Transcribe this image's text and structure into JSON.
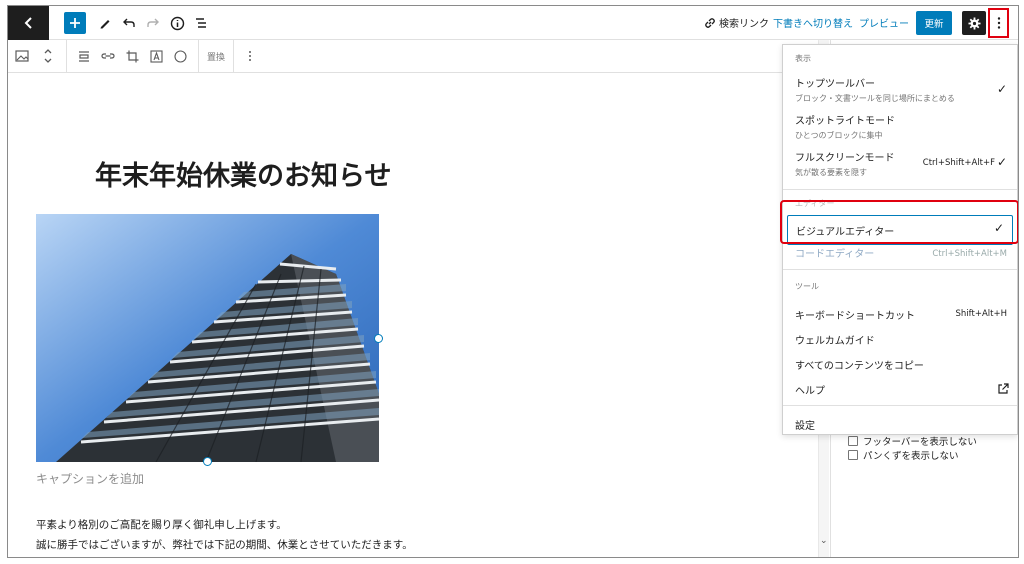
{
  "topbar": {
    "preview_link_label": "検索リンク",
    "switch_to_draft_label": "下書きへ切り替え",
    "preview_label": "プレビュー",
    "update_label": "更新"
  },
  "blockbar": {
    "replace_label": "置換"
  },
  "post": {
    "title": "年末年始休業のお知らせ",
    "caption_placeholder": "キャプションを追加",
    "paragraph_1": "平素より格別のご高配を賜り厚く御礼申し上げます。",
    "paragraph_2": "誠に勝手ではございますが、弊社では下記の期間、休業とさせていただきます。"
  },
  "sidebar": {
    "options": [
      "フッターバーを表示しない",
      "パンくずを表示しない"
    ]
  },
  "menu": {
    "view_heading": "表示",
    "top_toolbar": {
      "label": "トップツールバー",
      "desc": "ブロック・文書ツールを同じ場所にまとめる",
      "checked": true
    },
    "spotlight": {
      "label": "スポットライトモード",
      "desc": "ひとつのブロックに集中"
    },
    "fullscreen": {
      "label": "フルスクリーンモード",
      "desc": "気が散る要素を隠す",
      "shortcut": "Ctrl+Shift+Alt+F",
      "checked": true
    },
    "editor_heading": "エディター",
    "visual_editor": {
      "label": "ビジュアルエディター",
      "checked": true
    },
    "code_editor": {
      "label": "コードエディター",
      "shortcut": "Ctrl+Shift+Alt+M"
    },
    "tools_heading": "ツール",
    "keyboard_shortcuts": {
      "label": "キーボードショートカット",
      "shortcut": "Shift+Alt+H"
    },
    "welcome_guide": {
      "label": "ウェルカムガイド"
    },
    "copy_all": {
      "label": "すべてのコンテンツをコピー"
    },
    "help": {
      "label": "ヘルプ"
    },
    "preferences": {
      "label": "設定"
    }
  },
  "colors": {
    "accent": "#007cba",
    "highlight": "#e0000f",
    "dark": "#1e1e1e"
  }
}
